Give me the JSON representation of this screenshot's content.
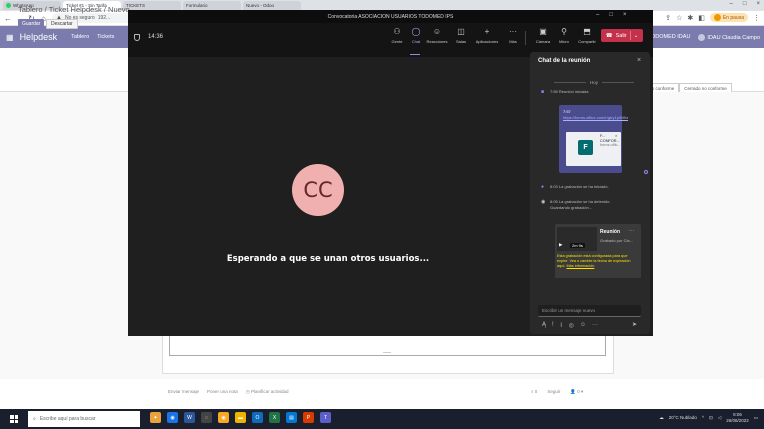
{
  "browser": {
    "tabs": [
      {
        "label": "WhatsApp",
        "active": false
      },
      {
        "label": "Ticket #1 - Sin Tarifa",
        "active": true
      },
      {
        "label": "TICKETS",
        "active": false
      },
      {
        "label": "Formulario",
        "active": false
      },
      {
        "label": "Nuevo - Odoo",
        "active": false
      }
    ],
    "url_prefix": "No es seguro",
    "url_text": "192...",
    "profile_status": "En pausa"
  },
  "odoo": {
    "app_name": "Helpdesk",
    "menus": [
      "Tablero",
      "Tickets"
    ],
    "right_items": [
      "TODOMED IDAU",
      "IDAU Claudia Campo"
    ],
    "breadcrumb": "Tablero / Ticket Helpdesk / Nuevo",
    "save_label": "Guardar",
    "discard_label": "Descartar",
    "stages": [
      "Cerrado conforme",
      "Cerrado no conforme"
    ],
    "chatter_left": [
      "Enviar mensaje",
      "Poner una nota",
      "Planificar actividad"
    ],
    "chatter_right": [
      "0",
      "Seguir",
      "0"
    ]
  },
  "teams": {
    "window_title": "Convocatoria ASOCIACION USUARIOS TODOMED IPS",
    "timer": "14:36",
    "toolbar": [
      {
        "icon": "people-icon",
        "label": "Gente"
      },
      {
        "icon": "chat-icon",
        "label": "Chat",
        "active": true
      },
      {
        "icon": "reactions-icon",
        "label": "Reacciones"
      },
      {
        "icon": "rooms-icon",
        "label": "Salas"
      },
      {
        "icon": "apps-icon",
        "label": "Aplicaciones"
      },
      {
        "icon": "more-icon",
        "label": "Más"
      },
      {
        "icon": "camera-icon",
        "label": "Cámara"
      },
      {
        "icon": "mic-icon",
        "label": "Micro"
      },
      {
        "icon": "share-icon",
        "label": "Compartir"
      }
    ],
    "leave_label": "Salir",
    "participant_initials": "CC",
    "waiting_text": "Esperando a que se unan otros usuarios...",
    "chat": {
      "title": "Chat de la reunión",
      "day_label": "Hoy",
      "events": [
        {
          "time": "7:55",
          "text": "Reunión iniciada"
        },
        {
          "time": "8:03",
          "text": "La grabación se ha iniciado."
        },
        {
          "time": "8:05",
          "text": "La grabación se ha detenido. Guardando grabación..."
        }
      ],
      "message": {
        "time": "7:57",
        "link": "https://forms.office.com/r/gtry1p00fbr",
        "card_title": "F...",
        "card_line1": "CONFOR...",
        "card_line2": "forms.offic..."
      },
      "recording": {
        "title": "Reunión",
        "subtitle": "Grabado por Cla...",
        "duration": "2m 9s",
        "warning": "Esta grabación está configurada para que expire. Vea o cambie la fecha de expiración aquí.",
        "warning_link": "Más información"
      },
      "compose_placeholder": "Escribir un mensaje nuevo"
    }
  },
  "taskbar": {
    "search_placeholder": "Escribe aquí para buscar",
    "weather": "20°C Nublado",
    "time": "8:06",
    "date": "26/08/2022"
  }
}
